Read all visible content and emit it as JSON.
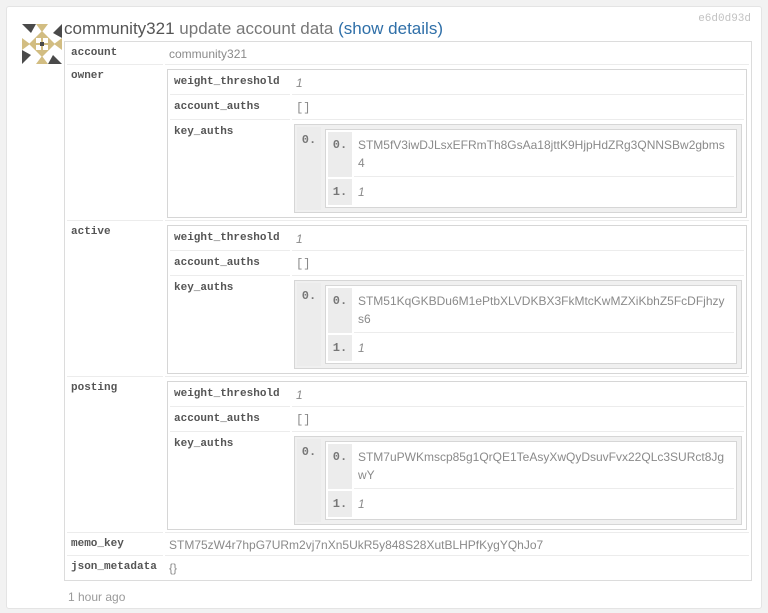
{
  "op": {
    "hash": "e6d0d93d",
    "user": "community321",
    "action": "update account data",
    "show_details": "(show details)",
    "timestamp": "1 hour ago"
  },
  "labels": {
    "account": "account",
    "owner": "owner",
    "active": "active",
    "posting": "posting",
    "memo_key": "memo_key",
    "json_metadata": "json_metadata",
    "weight_threshold": "weight_threshold",
    "account_auths": "account_auths",
    "key_auths": "key_auths",
    "idx0": "0.",
    "idx1": "1."
  },
  "fields": {
    "account": "community321",
    "owner": {
      "weight_threshold": "1",
      "account_auths": "[]",
      "key": "STM5fV3iwDJLsxEFRmTh8GsAa18jttK9HjpHdZRg3QNNSBw2gbms4",
      "weight": "1"
    },
    "active": {
      "weight_threshold": "1",
      "account_auths": "[]",
      "key": "STM51KqGKBDu6M1ePtbXLVDKBX3FkMtcKwMZXiKbhZ5FcDFjhzys6",
      "weight": "1"
    },
    "posting": {
      "weight_threshold": "1",
      "account_auths": "[]",
      "key": "STM7uPWKmscp85g1QrQE1TeAsyXwQyDsuvFvx22QLc3SURct8JgwY",
      "weight": "1"
    },
    "memo_key": "STM75zW4r7hpG7URm2vj7nXn5UkR5y848S28XutBLHPfKygYQhJo7",
    "json_metadata": "{}"
  },
  "icons": {
    "avatar": "quilt-pattern-avatar-icon"
  },
  "colors": {
    "link": "#2f6fa8",
    "avatar_gold": "#d2bd82",
    "avatar_dark": "#4a4a4a"
  }
}
